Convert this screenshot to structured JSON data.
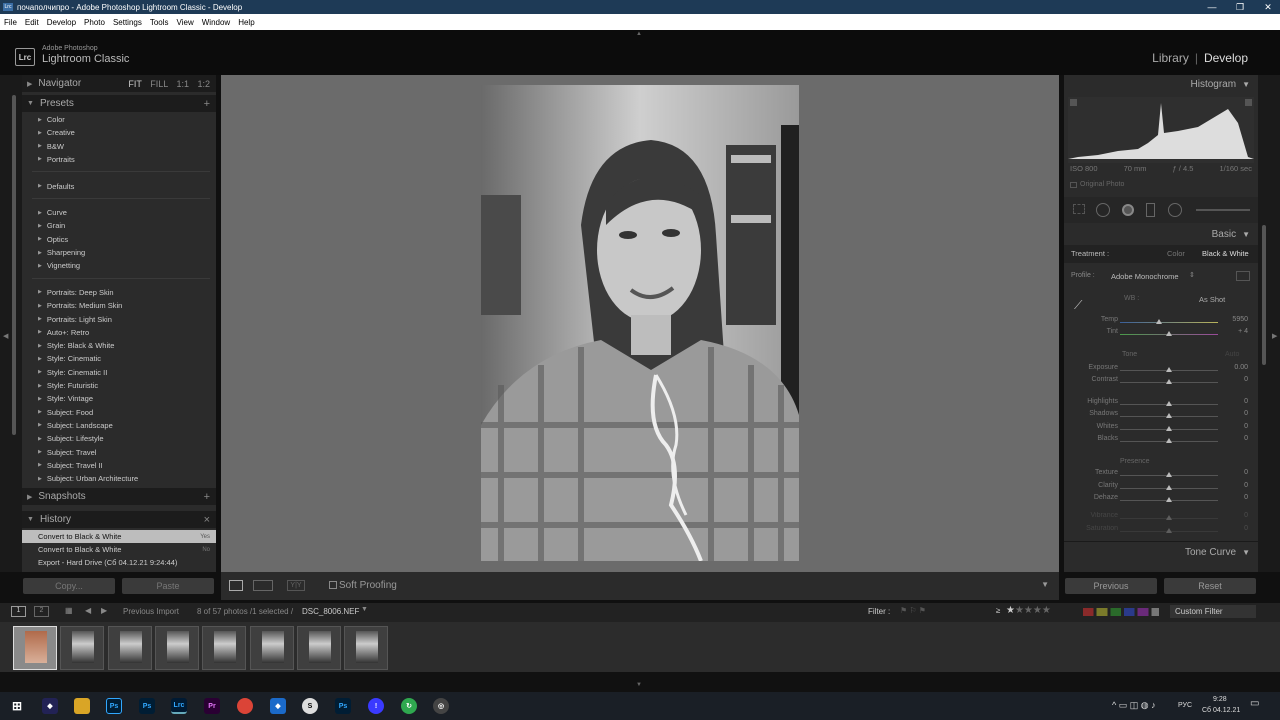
{
  "window": {
    "title": "почаполчипро - Adobe Photoshop Lightroom Classic - Develop",
    "app_badge": "Lrc",
    "minimize": "—",
    "restore": "❐",
    "close": "✕"
  },
  "menu": [
    "File",
    "Edit",
    "Develop",
    "Photo",
    "Settings",
    "Tools",
    "View",
    "Window",
    "Help"
  ],
  "identity": {
    "logo": "Lrc",
    "line1": "Adobe Photoshop",
    "line2": "Lightroom Classic",
    "modules": [
      "Library",
      "Develop"
    ],
    "separator": "|",
    "active_module": "Develop"
  },
  "navigator": {
    "title": "Navigator",
    "zoom": [
      "FIT",
      "FILL",
      "1:1",
      "1:2"
    ]
  },
  "presets": {
    "title": "Presets",
    "groups": [
      [
        "Color",
        "Creative",
        "B&W",
        "Portraits"
      ],
      [
        "Defaults"
      ],
      [
        "Curve",
        "Grain",
        "Optics",
        "Sharpening",
        "Vignetting"
      ],
      [
        "Portraits: Deep Skin",
        "Portraits: Medium Skin",
        "Portraits: Light Skin",
        "Auto+: Retro",
        "Style: Black & White",
        "Style: Cinematic",
        "Style: Cinematic II",
        "Style: Futuristic",
        "Style: Vintage",
        "Subject: Food",
        "Subject: Landscape",
        "Subject: Lifestyle",
        "Subject: Travel",
        "Subject: Travel II",
        "Subject: Urban Architecture"
      ]
    ]
  },
  "snapshots": {
    "title": "Snapshots",
    "add": "+"
  },
  "history": {
    "title": "History",
    "close": "×",
    "items": [
      {
        "label": "Convert to Black & White",
        "value": "Yes",
        "selected": true
      },
      {
        "label": "Convert to Black & White",
        "value": "No",
        "selected": false
      },
      {
        "label": "Export - Hard Drive (Сб 04.12.21 9:24:44)",
        "value": "",
        "selected": false
      }
    ]
  },
  "left_buttons": {
    "copy": "Copy...",
    "paste": "Paste"
  },
  "toolbar": {
    "soft_proofing": "Soft Proofing"
  },
  "histogram": {
    "title": "Histogram",
    "iso": "ISO 800",
    "focal": "70 mm",
    "aperture": "ƒ / 4.5",
    "shutter": "1/160 sec",
    "original_photo": "Original Photo"
  },
  "basic": {
    "title": "Basic",
    "treatment_label": "Treatment :",
    "treatment_options": [
      "Color",
      "Black & White"
    ],
    "treatment_selected": "Black & White",
    "profile_label": "Profile :",
    "profile_value": "Adobe Monochrome",
    "wb_label": "WB :",
    "wb_value": "As Shot",
    "tone_label": "Tone",
    "tone_auto": "Auto",
    "presence_label": "Presence",
    "sliders": [
      {
        "label": "Temp",
        "value": "5950",
        "pos": 0.4
      },
      {
        "label": "Tint",
        "value": "+ 4",
        "pos": 0.5
      },
      {
        "label": "Exposure",
        "value": "0.00",
        "pos": 0.5
      },
      {
        "label": "Contrast",
        "value": "0",
        "pos": 0.5
      },
      {
        "label": "Highlights",
        "value": "0",
        "pos": 0.5
      },
      {
        "label": "Shadows",
        "value": "0",
        "pos": 0.5
      },
      {
        "label": "Whites",
        "value": "0",
        "pos": 0.5
      },
      {
        "label": "Blacks",
        "value": "0",
        "pos": 0.5
      },
      {
        "label": "Texture",
        "value": "0",
        "pos": 0.5
      },
      {
        "label": "Clarity",
        "value": "0",
        "pos": 0.5
      },
      {
        "label": "Dehaze",
        "value": "0",
        "pos": 0.5
      },
      {
        "label": "Vibrance",
        "value": "0",
        "pos": 0.5
      },
      {
        "label": "Saturation",
        "value": "0",
        "pos": 0.5
      }
    ]
  },
  "tone_curve": {
    "title": "Tone Curve"
  },
  "right_buttons": {
    "previous": "Previous",
    "reset": "Reset"
  },
  "filmbar": {
    "view1": "1",
    "view2": "2",
    "source": "Previous Import",
    "count": "8 of 57 photos /1 selected /",
    "filename": "DSC_8006.NEF",
    "filter_label": "Filter :",
    "custom_filter": "Custom Filter",
    "rating_op": "≥"
  },
  "filmstrip": {
    "count": 8
  },
  "taskbar": {
    "lang": "РУС",
    "time": "9:28",
    "date": "Сб 04.12.21"
  }
}
